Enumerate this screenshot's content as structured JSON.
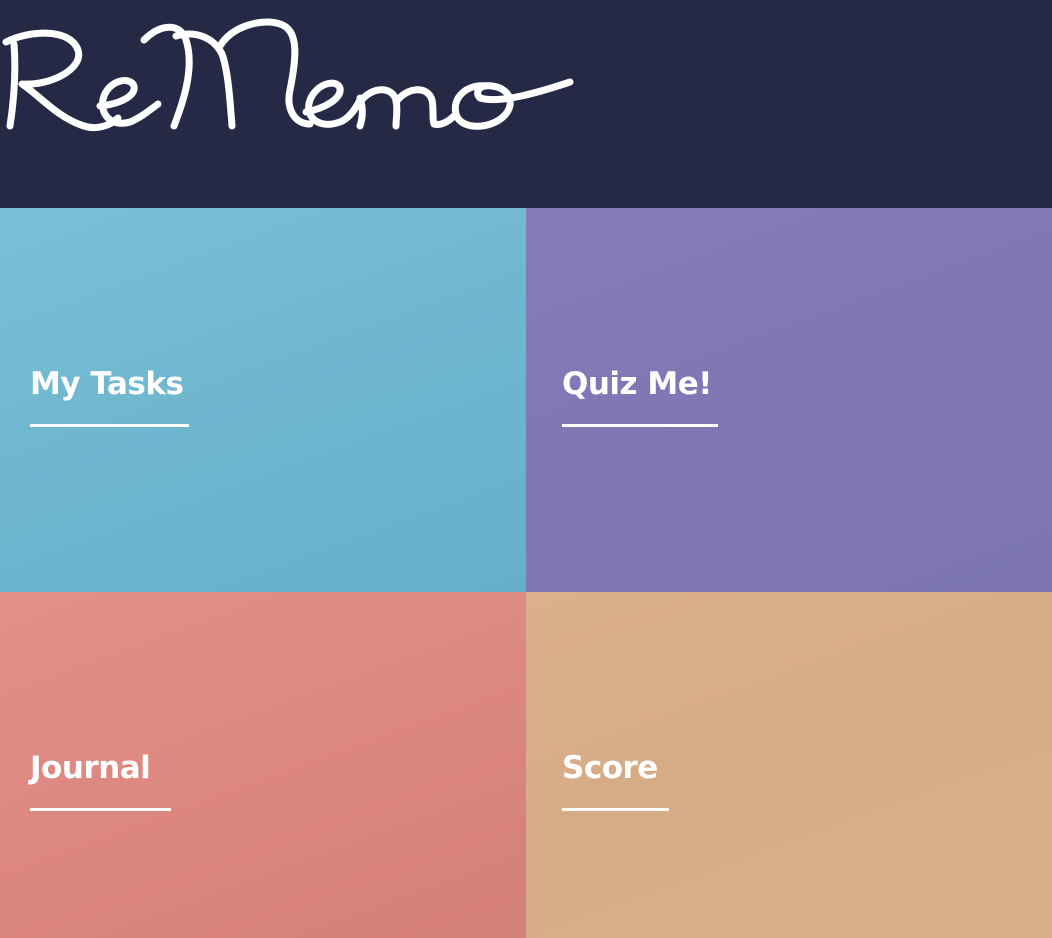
{
  "header": {
    "logo_text": "ReMemo"
  },
  "tiles": [
    {
      "label": "My Tasks",
      "color": "#6fb7cf"
    },
    {
      "label": "Quiz Me!",
      "color": "#7f77b4"
    },
    {
      "label": "Journal",
      "color": "#dc877f"
    },
    {
      "label": "Score",
      "color": "#d6ac86"
    }
  ],
  "colors": {
    "header_bg": "#252945",
    "text": "#ffffff"
  }
}
